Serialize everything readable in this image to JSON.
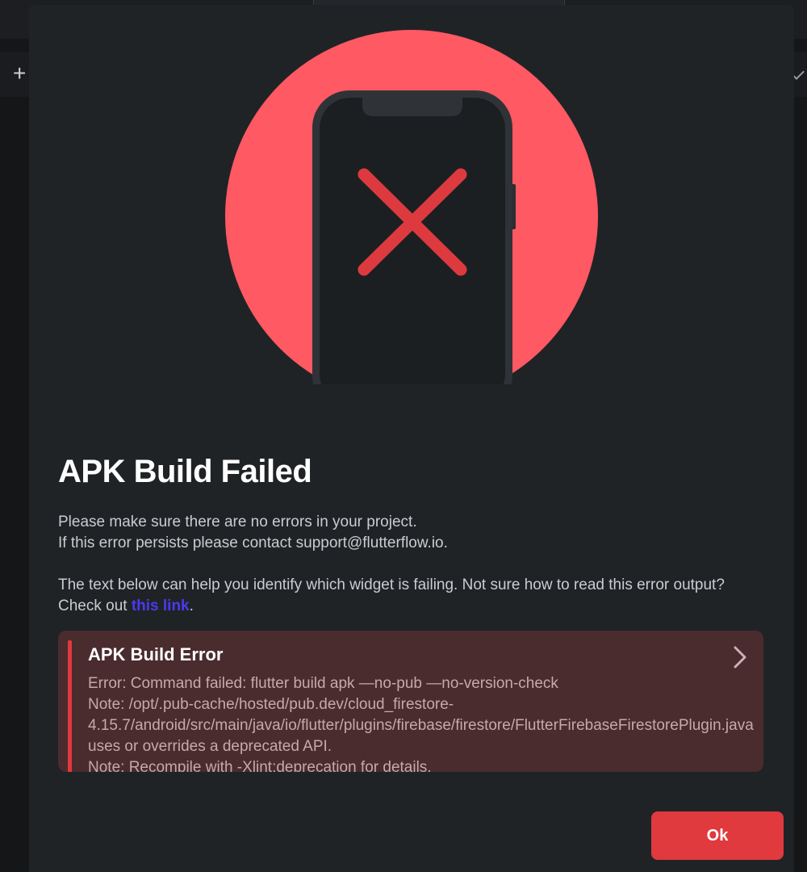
{
  "dialog": {
    "title": "APK Build Failed",
    "message_line1": "Please make sure there are no errors in your project.",
    "message_line2": "If this error persists please contact support@flutterflow.io.",
    "help_text_before_link": "The text below can help you identify which widget is failing. Not sure how to read this error output? Check out ",
    "help_link_text": "this link",
    "help_text_after_link": ".",
    "error_panel": {
      "title": "APK Build Error",
      "body": "Error: Command failed: flutter build apk —no-pub —no-version-check\nNote: /opt/.pub-cache/hosted/pub.dev/cloud_firestore-4.15.7/android/src/main/java/io/flutter/plugins/firebase/firestore/FlutterFirebaseFirestorePlugin.java uses or overrides a deprecated API.\nNote: Recompile with -Xlint:deprecation for details.",
      "expand_icon": "chevron-right-icon"
    },
    "ok_label": "Ok"
  },
  "background": {
    "add_label": "+"
  },
  "colors": {
    "modal_bg": "#1f2326",
    "accent_red": "#e0393e",
    "circle_red": "#ff5963",
    "error_panel_bg": "#4a2b2e",
    "link": "#4b39ef"
  },
  "icons": {
    "illustration": "phone-error-illustration",
    "error_mark": "x-mark-icon"
  }
}
